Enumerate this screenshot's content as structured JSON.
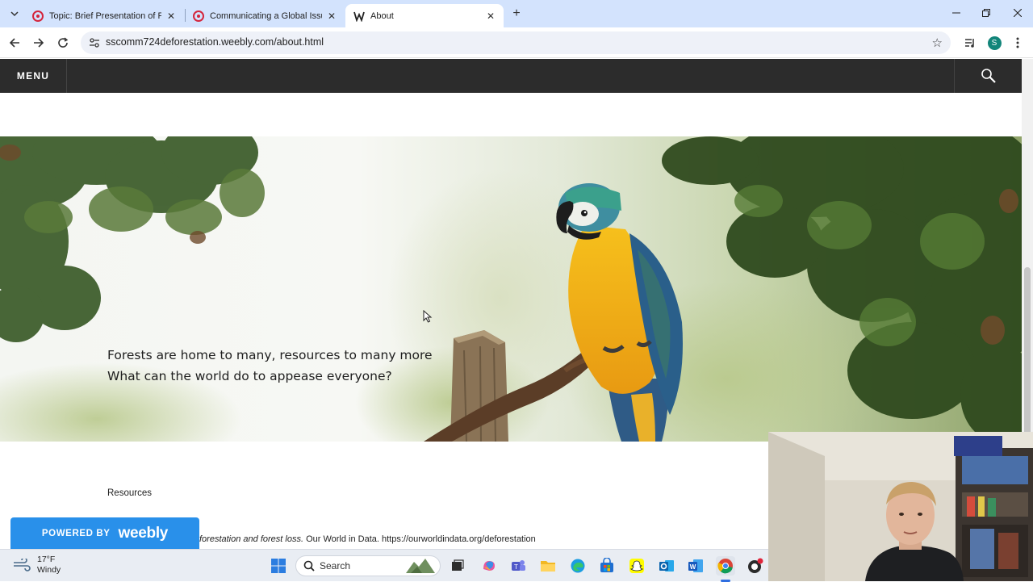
{
  "browser": {
    "tabs": [
      {
        "title": "Topic: Brief Presentation of Fina",
        "active": false
      },
      {
        "title": "Communicating a Global Issue:",
        "active": false
      },
      {
        "title": "About",
        "active": true
      }
    ],
    "url": "sscomm724deforestation.weebly.com/about.html",
    "profile_initial": "S"
  },
  "site": {
    "menu_label": "MENU",
    "hero_line1": "Forests are home to many, resources to many more",
    "hero_line2": "What can the world do to appease everyone?",
    "resources_heading": "Resources",
    "citation_italic": "forestation and forest loss.",
    "citation_rest": " Our World in Data. https://ourworldindata.org/deforestation",
    "badge_powered": "POWERED BY",
    "badge_brand": "weebly"
  },
  "taskbar": {
    "temperature": "17°F",
    "condition": "Windy",
    "search_label": "Search"
  },
  "colors": {
    "tabstrip": "#d3e3fd",
    "sitebar": "#2c2c2c",
    "weebly_blue": "#2990ea",
    "macaw_yellow": "#f2b41b",
    "macaw_blue": "#2a5f8a"
  }
}
